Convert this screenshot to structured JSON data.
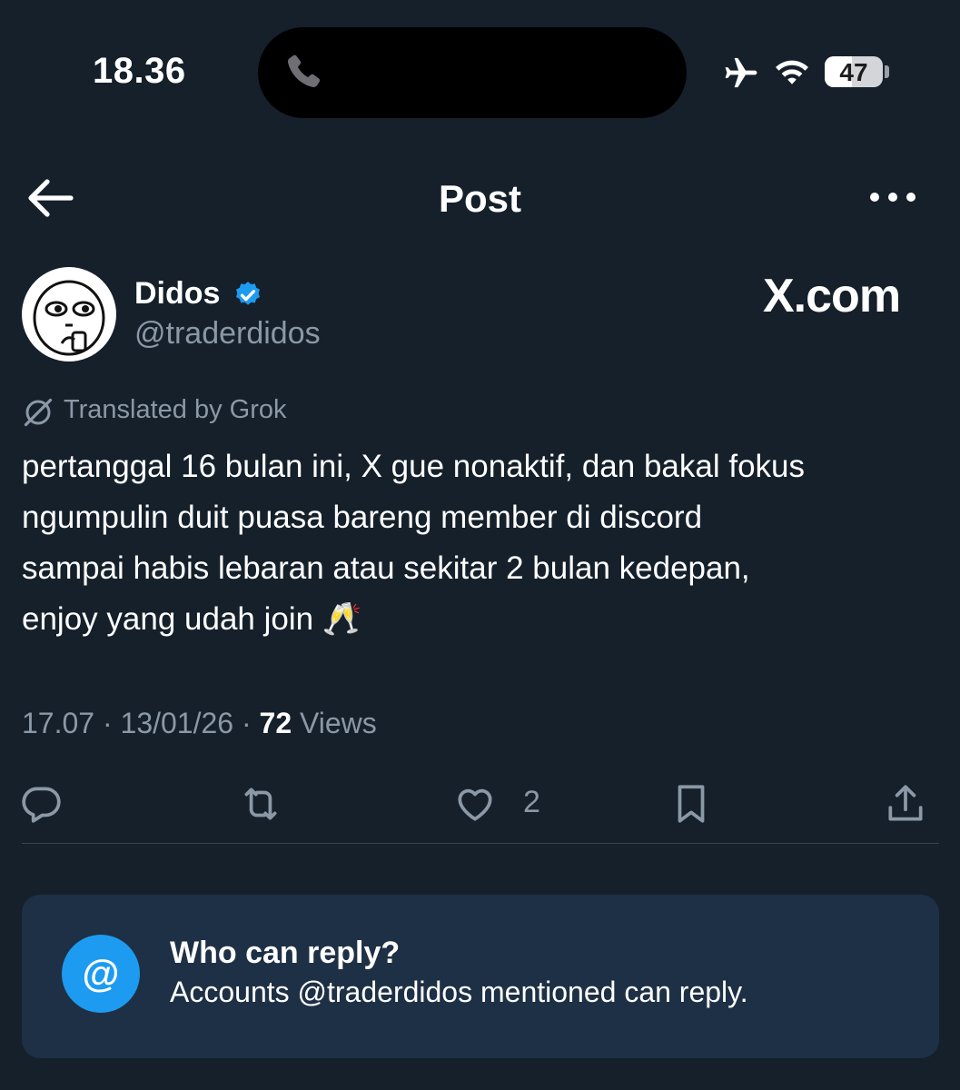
{
  "status_bar": {
    "time": "18.36",
    "battery_level": "47",
    "battery_fraction": 0.47,
    "icons": [
      "phone-icon",
      "airplane-icon",
      "wifi-icon",
      "battery-icon"
    ]
  },
  "header": {
    "title": "Post",
    "back_icon": "arrow-left-icon",
    "more_icon": "ellipsis-icon"
  },
  "author": {
    "name": "Didos",
    "handle": "@traderdidos",
    "verified": true,
    "watermark": "X.com"
  },
  "translation": {
    "label": "Translated by Grok"
  },
  "post": {
    "lines": [
      "pertanggal 16 bulan ini, X gue nonaktif, dan bakal fokus",
      "ngumpulin duit puasa bareng member di discord",
      "sampai habis lebaran atau sekitar 2 bulan kedepan,",
      "enjoy yang udah join 🥂"
    ]
  },
  "meta": {
    "time": "17.07",
    "date": "13/01/26",
    "views_count": "72",
    "views_label": "Views",
    "separator": "·"
  },
  "actions": {
    "like_count": "2",
    "icons": [
      "reply-icon",
      "retweet-icon",
      "like-icon",
      "bookmark-icon",
      "share-icon"
    ]
  },
  "reply_restriction": {
    "icon_text": "@",
    "title": "Who can reply?",
    "description": "Accounts @traderdidos mentioned can reply."
  },
  "colors": {
    "background": "#15202b",
    "accent": "#1d9bf0",
    "muted": "#8b98a5",
    "card": "#1e3045"
  }
}
